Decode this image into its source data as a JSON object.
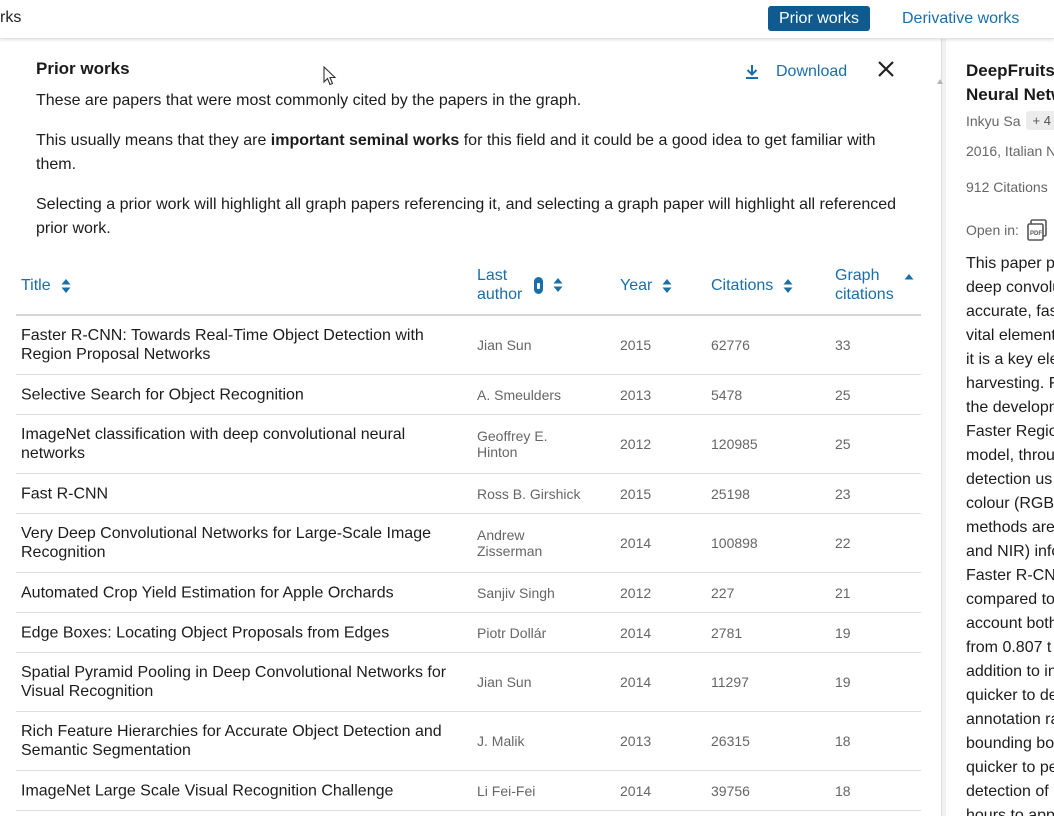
{
  "topbar": {
    "title_fragment": "rks",
    "tab_prior": "Prior works",
    "tab_derivative": "Derivative works"
  },
  "panel": {
    "title": "Prior works",
    "download_label": "Download",
    "desc1": "These are papers that were most commonly cited by the papers in the graph.",
    "desc2_pre": "This usually means that they are ",
    "desc2_bold": "important seminal works",
    "desc2_post": " for this field and it could be a good idea to get familiar with them.",
    "desc3": "Selecting a prior work will highlight all graph papers referencing it, and selecting a graph paper will highlight all referenced prior work."
  },
  "table": {
    "columns": {
      "title": "Title",
      "last_author_line1": "Last",
      "last_author_line2": "author",
      "year": "Year",
      "citations": "Citations",
      "graph_line1": "Graph",
      "graph_line2": "citations"
    },
    "rows": [
      {
        "title": "Faster R-CNN: Towards Real-Time Object Detection with Region Proposal Networks",
        "author": "Jian Sun",
        "year": "2015",
        "citations": "62776",
        "graph": "33"
      },
      {
        "title": "Selective Search for Object Recognition",
        "author": "A. Smeulders",
        "year": "2013",
        "citations": "5478",
        "graph": "25"
      },
      {
        "title": "ImageNet classification with deep convolutional neural networks",
        "author": "Geoffrey E. Hinton",
        "year": "2012",
        "citations": "120985",
        "graph": "25"
      },
      {
        "title": "Fast R-CNN",
        "author": "Ross B. Girshick",
        "year": "2015",
        "citations": "25198",
        "graph": "23"
      },
      {
        "title": "Very Deep Convolutional Networks for Large-Scale Image Recognition",
        "author": "Andrew Zisserman",
        "year": "2014",
        "citations": "100898",
        "graph": "22"
      },
      {
        "title": "Automated Crop Yield Estimation for Apple Orchards",
        "author": "Sanjiv Singh",
        "year": "2012",
        "citations": "227",
        "graph": "21"
      },
      {
        "title": "Edge Boxes: Locating Object Proposals from Edges",
        "author": "Piotr Dollár",
        "year": "2014",
        "citations": "2781",
        "graph": "19"
      },
      {
        "title": "Spatial Pyramid Pooling in Deep Convolutional Networks for Visual Recognition",
        "author": "Jian Sun",
        "year": "2014",
        "citations": "11297",
        "graph": "19"
      },
      {
        "title": "Rich Feature Hierarchies for Accurate Object Detection and Semantic Segmentation",
        "author": "J. Malik",
        "year": "2013",
        "citations": "26315",
        "graph": "18"
      },
      {
        "title": "ImageNet Large Scale Visual Recognition Challenge",
        "author": "Li Fei-Fei",
        "year": "2014",
        "citations": "39756",
        "graph": "18"
      }
    ]
  },
  "side": {
    "title_line1": "DeepFruits",
    "title_line2": "Neural Netw",
    "author": "Inkyu Sa",
    "more_authors": "+ 4",
    "meta": "2016, Italian N",
    "citations": "912 Citations",
    "open_in": "Open in:",
    "abstract_lines": [
      "This paper p",
      "deep convolu",
      "accurate, fas",
      "vital element",
      "it is a key ele",
      "harvesting. F",
      "the developn",
      "Faster Regio",
      "model, throu",
      "detection us",
      "colour (RGB)",
      "methods are",
      "and NIR) info",
      "Faster R-CNI",
      "compared to",
      "account both",
      "from 0.807 t",
      "addition to in",
      "quicker to de",
      "annotation ra",
      "bounding bo",
      "quicker to pe",
      "detection of",
      "hours to app"
    ]
  },
  "colors": {
    "accent": "#1a6fa8",
    "active_tab_bg": "#0f5a8e"
  }
}
